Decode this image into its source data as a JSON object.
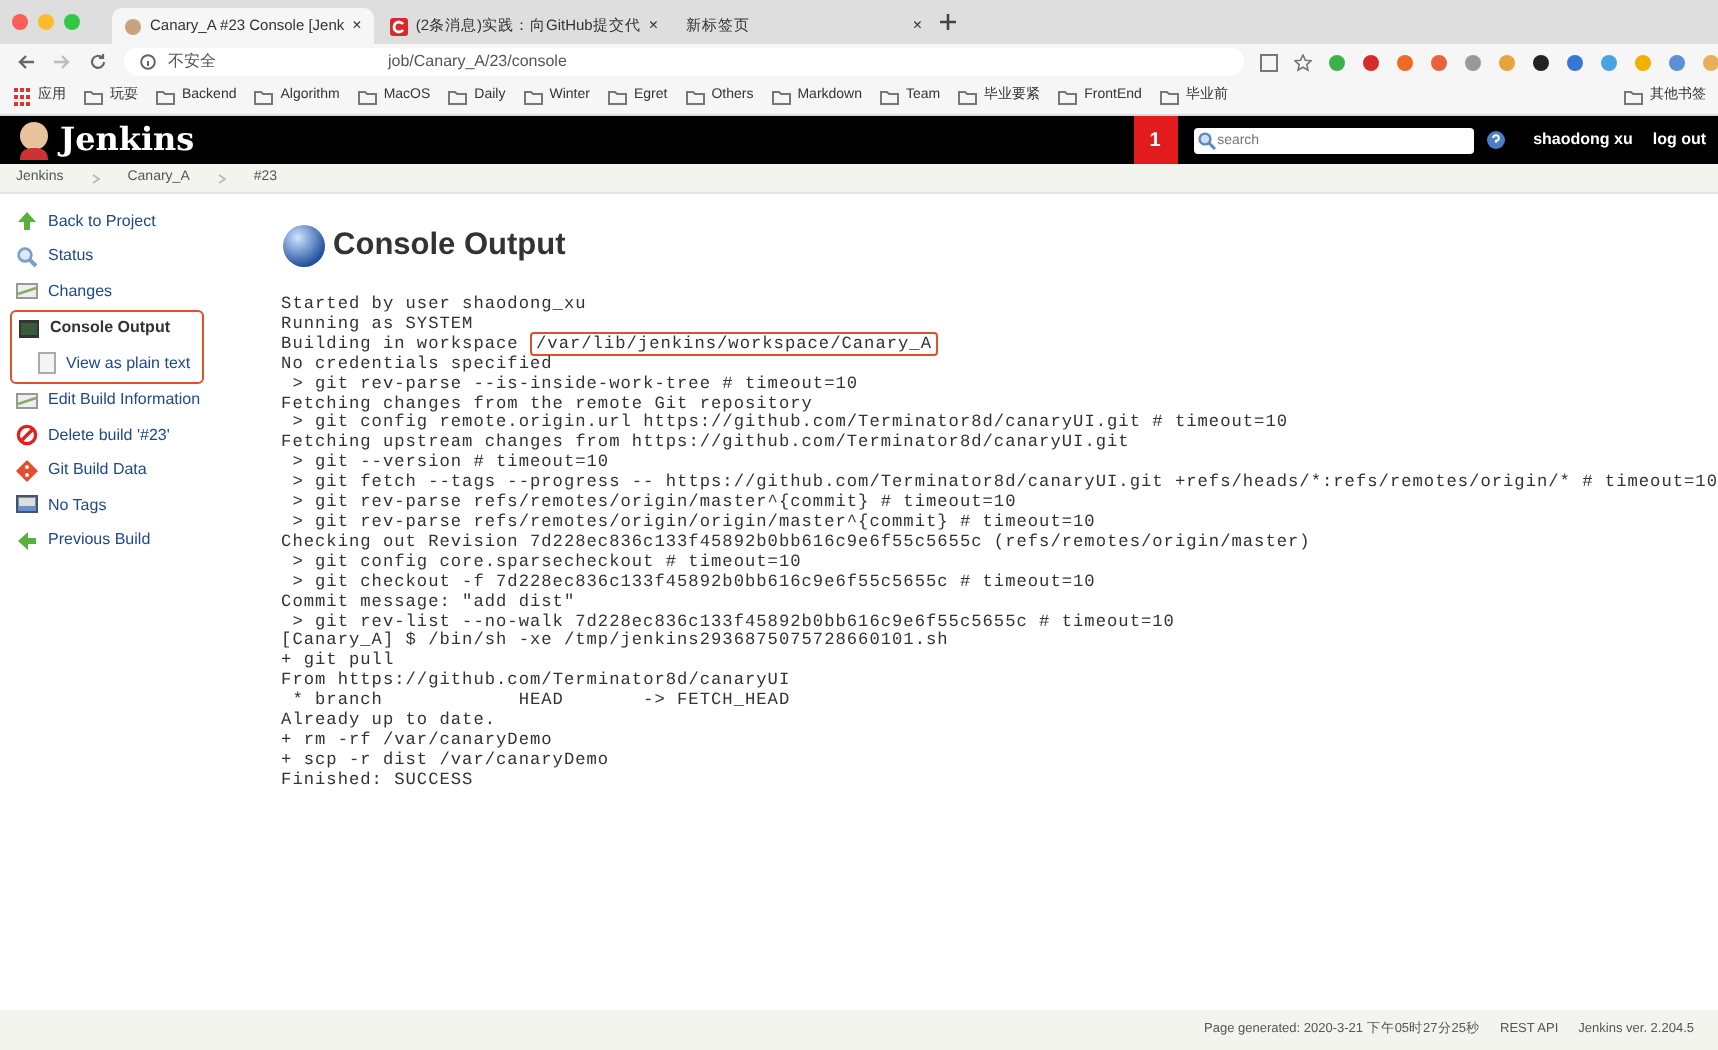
{
  "browser": {
    "tabs": [
      {
        "title": "Canary_A #23 Console [Jenk",
        "close": "×",
        "selected": true
      },
      {
        "title": "(2条消息)实践：向GitHub提交代",
        "close": "×",
        "selected": false
      },
      {
        "title": "新标签页",
        "close": "×",
        "selected": false
      }
    ],
    "security_label": "不安全",
    "url": "job/Canary_A/23/console",
    "bookmarks": [
      "应用",
      "玩耍",
      "Backend",
      "Algorithm",
      "MacOS",
      "Daily",
      "Winter",
      "Egret",
      "Others",
      "Markdown",
      "Team",
      "毕业要紧",
      "FrontEnd",
      "毕业前"
    ],
    "other_bookmarks": "其他书签"
  },
  "header": {
    "logo_text": "Jenkins",
    "notification_count": "1",
    "search": {
      "placeholder": "search"
    },
    "user": "shaodong xu",
    "logout": "log out"
  },
  "breadcrumbs": [
    "Jenkins",
    "Canary_A",
    "#23"
  ],
  "sidebar": {
    "items": [
      {
        "label": "Back to Project",
        "selected": false,
        "annotated": false
      },
      {
        "label": "Status",
        "selected": false,
        "annotated": false
      },
      {
        "label": "Changes",
        "selected": false,
        "annotated": false
      },
      {
        "label": "Console Output",
        "selected": true,
        "annotated": true,
        "children": [
          {
            "label": "View as plain text",
            "selected": false
          }
        ]
      },
      {
        "label": "Edit Build Information",
        "selected": false,
        "annotated": false
      },
      {
        "label": "Delete build '#23'",
        "selected": false,
        "annotated": false
      },
      {
        "label": "Git Build Data",
        "selected": false,
        "annotated": false
      },
      {
        "label": "No Tags",
        "selected": false,
        "annotated": false
      },
      {
        "label": "Previous Build",
        "selected": false,
        "annotated": false
      }
    ]
  },
  "console": {
    "title": "Console Output",
    "lines": [
      [
        {
          "kind": "text",
          "text": "Started by user "
        },
        {
          "kind": "link",
          "text": "shaodong_xu"
        }
      ],
      [
        {
          "kind": "text",
          "text": "Running as SYSTEM"
        }
      ],
      [
        {
          "kind": "text",
          "text": "Building in workspace "
        },
        {
          "kind": "highlight",
          "text": "/var/lib/jenkins/workspace/Canary_A"
        }
      ],
      [
        {
          "kind": "text",
          "text": "No credentials specified"
        }
      ],
      [
        {
          "kind": "text",
          "text": " > git rev-parse --is-inside-work-tree # timeout=10"
        }
      ],
      [
        {
          "kind": "text",
          "text": "Fetching changes from the remote Git repository"
        }
      ],
      [
        {
          "kind": "text",
          "text": " > git config remote.origin.url "
        },
        {
          "kind": "link",
          "text": "https://github.com/Terminator8d/canaryUI.git"
        },
        {
          "kind": "text",
          "text": " # timeout=10"
        }
      ],
      [
        {
          "kind": "text",
          "text": "Fetching upstream changes from "
        },
        {
          "kind": "link",
          "text": "https://github.com/Terminator8d/canaryUI.git"
        }
      ],
      [
        {
          "kind": "text",
          "text": " > git --version # timeout=10"
        }
      ],
      [
        {
          "kind": "text",
          "text": " > git fetch --tags --progress -- "
        },
        {
          "kind": "link",
          "text": "https://github.com/Terminator8d/canaryUI.git"
        },
        {
          "kind": "text",
          "text": " +refs/heads/*:refs/remotes/origin/* # timeout=10"
        }
      ],
      [
        {
          "kind": "text",
          "text": " > git rev-parse refs/remotes/origin/master^{commit} # timeout=10"
        }
      ],
      [
        {
          "kind": "text",
          "text": " > git rev-parse refs/remotes/origin/origin/master^{commit} # timeout=10"
        }
      ],
      [
        {
          "kind": "text",
          "text": "Checking out Revision 7d228ec836c133f45892b0bb616c9e6f55c5655c (refs/remotes/origin/master)"
        }
      ],
      [
        {
          "kind": "text",
          "text": " > git config core.sparsecheckout # timeout=10"
        }
      ],
      [
        {
          "kind": "text",
          "text": " > git checkout -f 7d228ec836c133f45892b0bb616c9e6f55c5655c # timeout=10"
        }
      ],
      [
        {
          "kind": "text",
          "text": "Commit message: \"add dist\""
        }
      ],
      [
        {
          "kind": "text",
          "text": " > git rev-list --no-walk 7d228ec836c133f45892b0bb616c9e6f55c5655c # timeout=10"
        }
      ],
      [
        {
          "kind": "text",
          "text": "[Canary_A] $ /bin/sh -xe /tmp/jenkins2936875075728660101.sh"
        }
      ],
      [
        {
          "kind": "text",
          "text": "+ git pull"
        }
      ],
      [
        {
          "kind": "text",
          "text": "From "
        },
        {
          "kind": "link",
          "text": "https://github.com/Terminator8d/canaryUI"
        }
      ],
      [
        {
          "kind": "text",
          "text": " * branch            HEAD       -> FETCH_HEAD"
        }
      ],
      [
        {
          "kind": "text",
          "text": "Already up to date."
        }
      ],
      [
        {
          "kind": "text",
          "text": "+ rm -rf /var/canaryDemo"
        }
      ],
      [
        {
          "kind": "text",
          "text": "+ scp -r dist /var/canaryDemo"
        }
      ],
      [
        {
          "kind": "text",
          "text": "Finished: SUCCESS"
        }
      ]
    ]
  },
  "footer": {
    "generated": "Page generated: 2020-3-21 下午05时27分25秒",
    "rest_api": "REST API",
    "version": "Jenkins ver. 2.204.5"
  }
}
